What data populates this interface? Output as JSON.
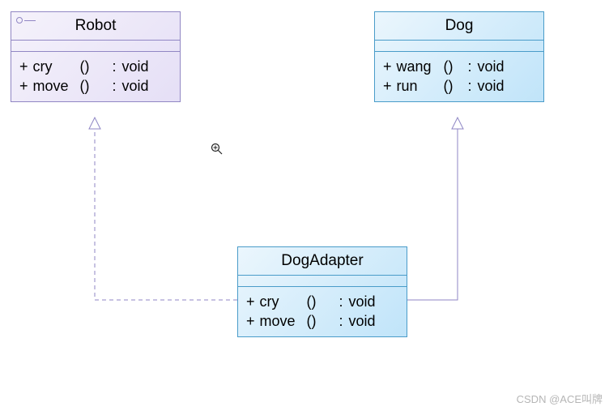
{
  "diagram": {
    "robot": {
      "title": "Robot",
      "methods": [
        {
          "name": "cry",
          "paren": "()",
          "ret": "void"
        },
        {
          "name": "move",
          "paren": "()",
          "ret": "void"
        }
      ]
    },
    "dog": {
      "title": "Dog",
      "methods": [
        {
          "name": "wang",
          "paren": "()",
          "ret": "void"
        },
        {
          "name": "run",
          "paren": "()",
          "ret": "void"
        }
      ]
    },
    "adapter": {
      "title": "DogAdapter",
      "methods": [
        {
          "name": "cry",
          "paren": "()",
          "ret": "void"
        },
        {
          "name": "move",
          "paren": "()",
          "ret": "void"
        }
      ]
    }
  },
  "symbols": {
    "plus": "+",
    "colon": ":"
  },
  "watermark": "CSDN @ACE叫牌",
  "chart_data": {
    "type": "uml-class-diagram",
    "classes": [
      {
        "name": "Robot",
        "stereotype": "interface",
        "operations": [
          {
            "visibility": "+",
            "name": "cry",
            "returns": "void"
          },
          {
            "visibility": "+",
            "name": "move",
            "returns": "void"
          }
        ]
      },
      {
        "name": "Dog",
        "stereotype": "class",
        "operations": [
          {
            "visibility": "+",
            "name": "wang",
            "returns": "void"
          },
          {
            "visibility": "+",
            "name": "run",
            "returns": "void"
          }
        ]
      },
      {
        "name": "DogAdapter",
        "stereotype": "class",
        "operations": [
          {
            "visibility": "+",
            "name": "cry",
            "returns": "void"
          },
          {
            "visibility": "+",
            "name": "move",
            "returns": "void"
          }
        ]
      }
    ],
    "relationships": [
      {
        "from": "DogAdapter",
        "to": "Robot",
        "type": "realization"
      },
      {
        "from": "DogAdapter",
        "to": "Dog",
        "type": "generalization"
      }
    ]
  }
}
